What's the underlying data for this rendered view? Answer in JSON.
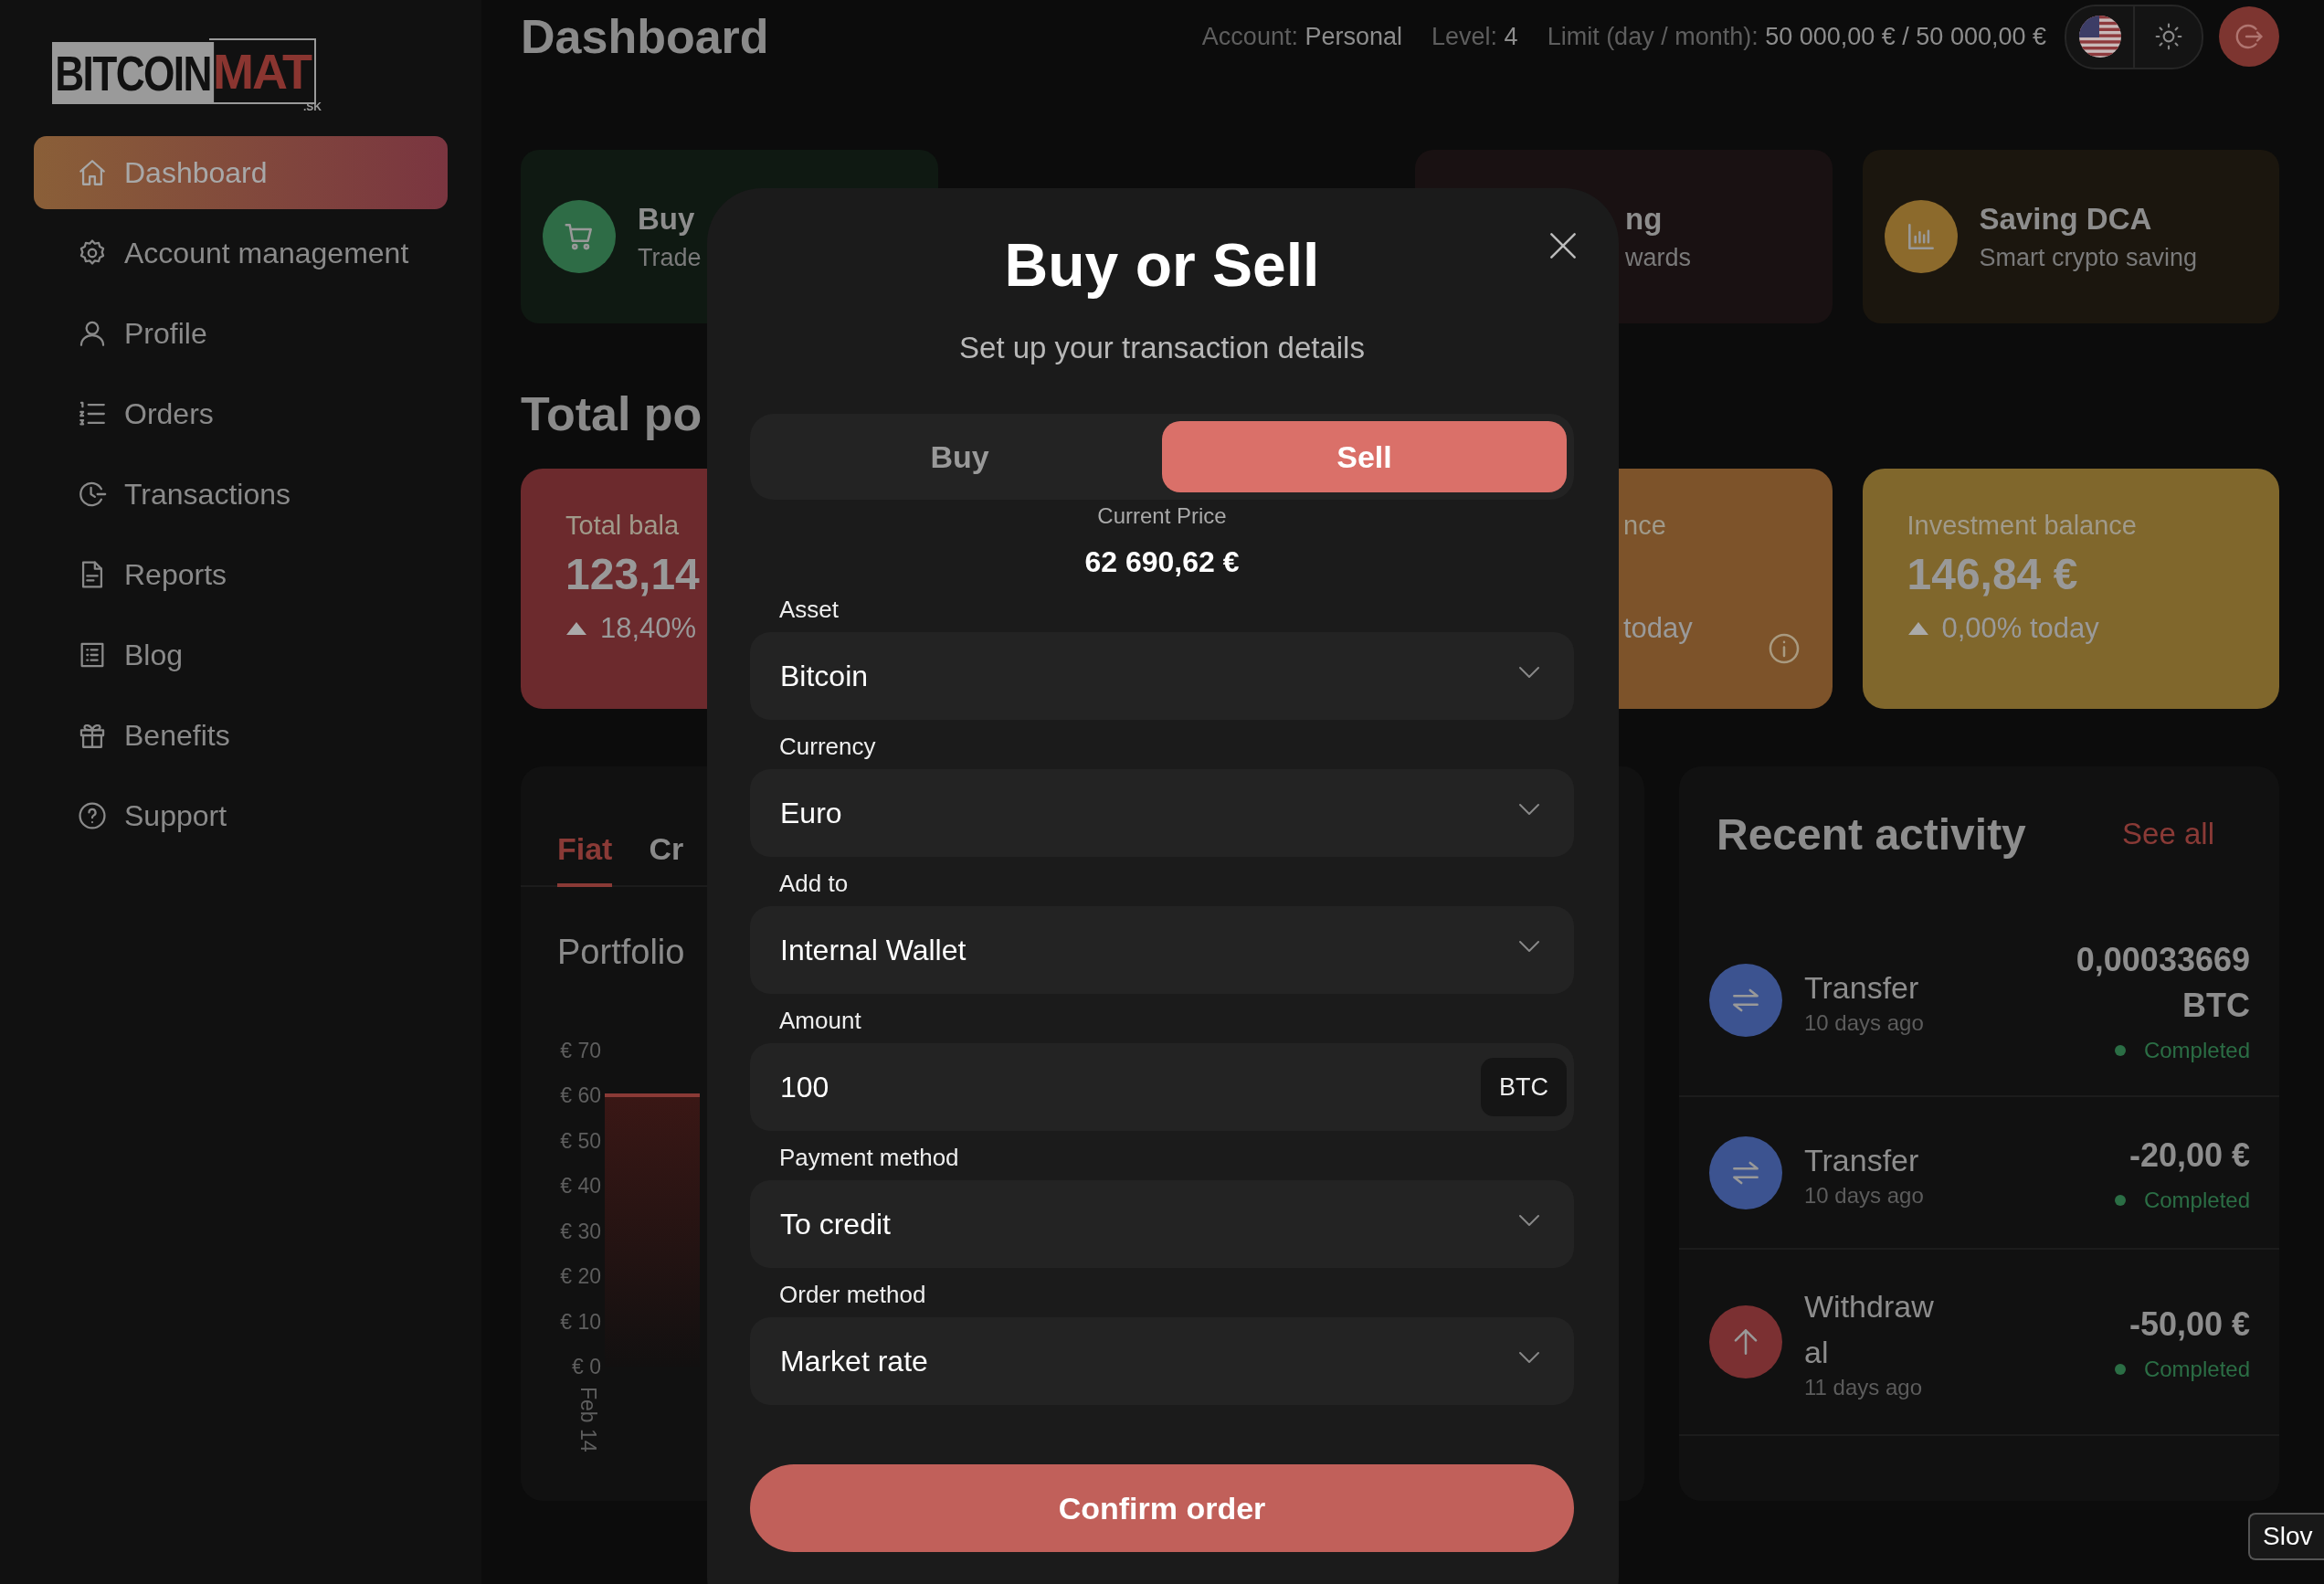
{
  "sidebar": {
    "logo": {
      "word": "BITCOIN",
      "mark": "MAT",
      "suffix": ".SK"
    },
    "items": [
      {
        "label": "Dashboard",
        "selected": true
      },
      {
        "label": "Account management",
        "selected": false
      },
      {
        "label": "Profile",
        "selected": false
      },
      {
        "label": "Orders",
        "selected": false
      },
      {
        "label": "Transactions",
        "selected": false
      },
      {
        "label": "Reports",
        "selected": false
      },
      {
        "label": "Blog",
        "selected": false
      },
      {
        "label": "Benefits",
        "selected": false
      },
      {
        "label": "Support",
        "selected": false
      }
    ]
  },
  "header": {
    "title": "Dashboard",
    "account_label": "Account:",
    "account": "Personal",
    "level_label": "Level:",
    "level": "4",
    "limit_label": "Limit (day / month):",
    "limit": "50 000,00 € / 50 000,00 €"
  },
  "action_cards": [
    {
      "kind": "trade",
      "color": "#0f1912",
      "covered": false,
      "title": "Buy",
      "subtitle": "Trade"
    },
    {
      "kind": "blank",
      "color": "#191112",
      "covered": true,
      "title": "ng",
      "subtitle": "wards"
    },
    {
      "kind": "saving",
      "color": "#1b160e",
      "covered": false,
      "title": "Saving DCA",
      "subtitle": "Smart crypto saving"
    }
  ],
  "portfolio_heading": "Total po",
  "balance_cards": [
    {
      "color": "#6c2a2d",
      "covered": false,
      "title": "Total bala",
      "value": "123,14",
      "change": "18,40%"
    },
    {
      "color": "#7d532a",
      "covered": true,
      "title": "nce",
      "change": "today",
      "info": true
    },
    {
      "color": "#80672c",
      "covered": false,
      "title": "Investment balance",
      "value": "146,84 €",
      "change": "0,00% today"
    }
  ],
  "portfolio": {
    "tabs": [
      {
        "label": "Fiat",
        "selected": true
      },
      {
        "label": "Cr",
        "selected": false
      }
    ],
    "title": "Portfolio",
    "y_ticks": [
      "€ 70",
      "€ 60",
      "€ 50",
      "€ 40",
      "€ 30",
      "€ 20",
      "€ 10",
      "€ 0"
    ],
    "x_label": "Feb 14"
  },
  "recent_activity": {
    "title": "Recent activity",
    "link": "See all",
    "items": [
      {
        "kind": "transfer",
        "title": "Transfer",
        "time": "10 days ago",
        "amount": "0,00033669 BTC",
        "status": "Completed"
      },
      {
        "kind": "transfer",
        "title": "Transfer",
        "time": "10 days ago",
        "amount": "-20,00 €",
        "status": "Completed"
      },
      {
        "kind": "withdrawal",
        "title": "Withdrawal",
        "time": "11 days ago",
        "amount": "-50,00 €",
        "status": "Completed"
      }
    ]
  },
  "modal": {
    "title": "Buy or Sell",
    "subtitle": "Set up your transaction details",
    "options": [
      {
        "label": "Buy",
        "selected": false
      },
      {
        "label": "Sell",
        "selected": true
      }
    ],
    "price_label": "Current Price",
    "price": "62 690,62 €",
    "fields": [
      {
        "label": "Asset",
        "kind": "select",
        "value": "Bitcoin"
      },
      {
        "label": "Currency",
        "kind": "select",
        "value": "Euro"
      },
      {
        "label": "Add to",
        "kind": "select",
        "value": "Internal Wallet"
      },
      {
        "label": "Amount",
        "kind": "amount",
        "value": "100",
        "unit": "BTC"
      },
      {
        "label": "Payment method",
        "kind": "select",
        "value": "To credit"
      },
      {
        "label": "Order method",
        "kind": "select",
        "value": "Market rate"
      }
    ],
    "confirm": "Confirm order"
  },
  "tooltip": "Slov"
}
